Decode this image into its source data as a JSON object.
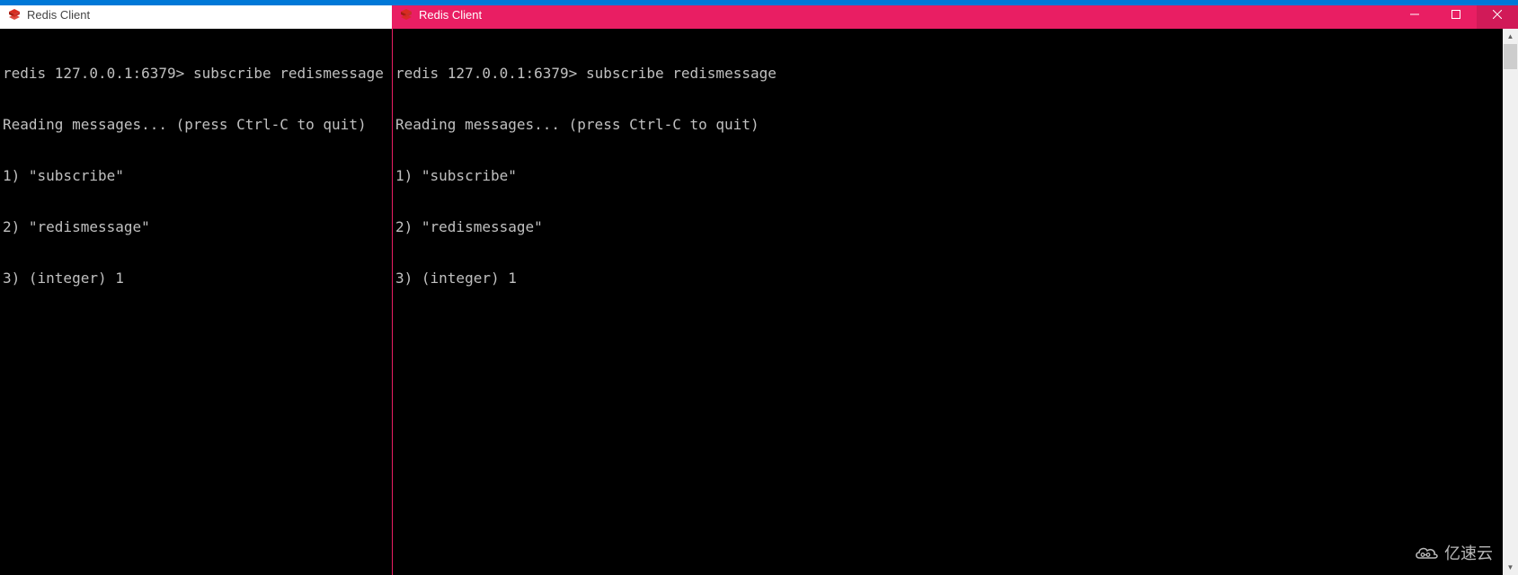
{
  "topAccentColor": "#0078d7",
  "windows": {
    "left": {
      "title": "Redis Client",
      "active": false,
      "terminal": {
        "prompt": "redis 127.0.0.1:6379>",
        "command": "subscribe redismessage",
        "output": [
          "Reading messages... (press Ctrl-C to quit)",
          "1) \"subscribe\"",
          "2) \"redismessage\"",
          "3) (integer) 1"
        ]
      }
    },
    "right": {
      "title": "Redis Client",
      "active": true,
      "activeColor": "#e91e63",
      "controls": {
        "minimize": "—",
        "maximize": "☐",
        "close": "✕"
      },
      "terminal": {
        "prompt": "redis 127.0.0.1:6379>",
        "command": "subscribe redismessage",
        "output": [
          "Reading messages... (press Ctrl-C to quit)",
          "1) \"subscribe\"",
          "2) \"redismessage\"",
          "3) (integer) 1"
        ]
      }
    }
  },
  "watermark": {
    "text": "亿速云"
  }
}
